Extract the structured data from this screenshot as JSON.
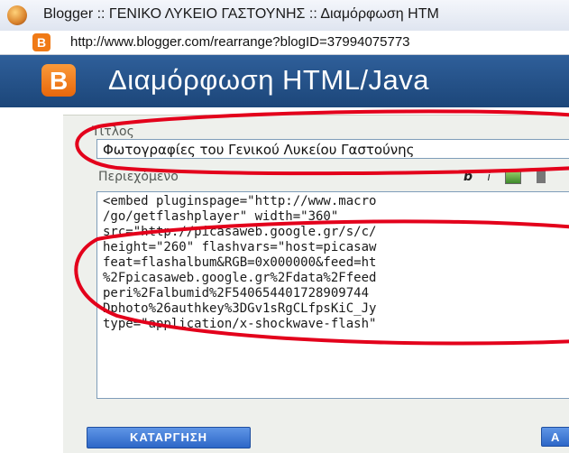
{
  "window": {
    "title": "Blogger :: ΓΕΝΙΚΟ ΛΥΚΕΙΟ ΓΑΣΤΟΥΝΗΣ :: Διαμόρφωση HTM",
    "url": "http://www.blogger.com/rearrange?blogID=37994075773"
  },
  "dialog": {
    "logo_letter": "B",
    "title": "Διαμόρφωση HTML/Java"
  },
  "form": {
    "title_label": "Τίτλος",
    "title_value": "Φωτογραφίες του Γενικού Λυκείου Γαστούνης",
    "content_label": "Περιεχόμενο",
    "toolbar": {
      "bold": "b",
      "italic": "i"
    },
    "code_lines": [
      "<embed pluginspage=\"http://www.macro",
      "/go/getflashplayer\" width=\"360\"",
      "src=\"http://picasaweb.google.gr/s/c/",
      "height=\"260\" flashvars=\"host=picasaw",
      "feat=flashalbum&RGB=0x000000&feed=ht",
      "%2Fpicasaweb.google.gr%2Fdata%2Ffeed",
      "peri%2Falbumid%2F540654401728909744",
      "Dphoto%26authkey%3DGv1sRgCLfpsKiC_Jy",
      "type=\"application/x-shockwave-flash\""
    ],
    "remove_button": "ΚΑΤΑΡΓΗΣΗ",
    "ok_button": "Α"
  },
  "icons": {
    "app": "firefox-icon",
    "favicon": "blogger-favicon",
    "image_tool": "image-icon"
  },
  "colors": {
    "header_blue": "#1c4679",
    "button_blue": "#2d67c7",
    "blogger_orange": "#f07a16",
    "annotation_red": "#e3001b"
  }
}
